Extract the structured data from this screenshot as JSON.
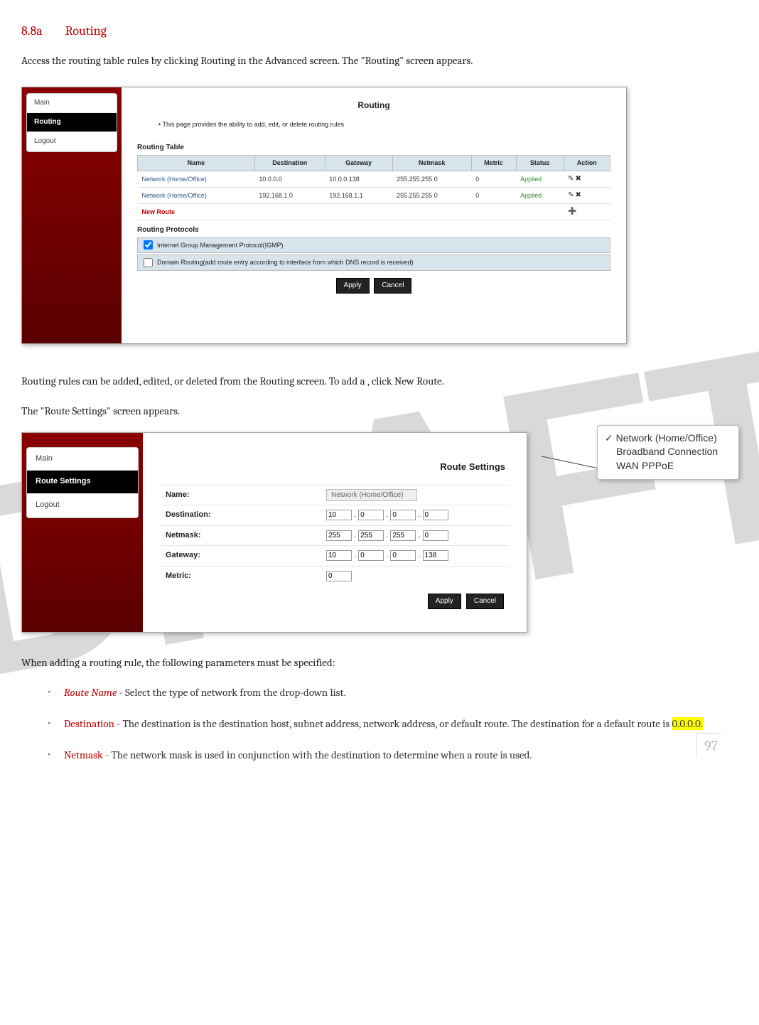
{
  "watermark": "DRAFT",
  "section": {
    "number": "8.8a",
    "title": "Routing"
  },
  "intro": "Access the routing table rules by clicking Routing in the Advanced screen. The \"Routing\" screen appears.",
  "shot1": {
    "sidebar": {
      "items": [
        "Main",
        "Routing",
        "Logout"
      ],
      "active": "Routing"
    },
    "title": "Routing",
    "note": "This page provides the ability to add, edit, or delete routing rules",
    "table_heading": "Routing Table",
    "columns": [
      "Name",
      "Destination",
      "Gateway",
      "Netmask",
      "Metric",
      "Status",
      "Action"
    ],
    "rows": [
      {
        "name": "Network (Home/Office)",
        "dest": "10.0.0.0",
        "gw": "10.0.0.138",
        "mask": "255.255.255.0",
        "metric": "0",
        "status": "Applied"
      },
      {
        "name": "Network (Home/Office)",
        "dest": "192.168.1.0",
        "gw": "192.168.1.1",
        "mask": "255.255.255.0",
        "metric": "0",
        "status": "Applied"
      }
    ],
    "new_route": "New Route",
    "protocols_heading": "Routing Protocols",
    "proto_igmp": {
      "checked": true,
      "label": "Internet Group Management Protocol(IGMP)"
    },
    "proto_domain": {
      "checked": false,
      "label": "Domain Routing(add route entry according to interface from which DNS record is received)"
    },
    "apply": "Apply",
    "cancel": "Cancel"
  },
  "mid_text_1": "Routing rules can be added, edited, or deleted from the Routing screen. To add a , click New Route.",
  "mid_text_2": "The \"Route Settings\" screen appears.",
  "shot2": {
    "sidebar": {
      "items": [
        "Main",
        "Route Settings",
        "Logout"
      ],
      "active": "Route Settings"
    },
    "title": "Route Settings",
    "fields": {
      "name_label": "Name:",
      "name_value": "Network (Home/Office)",
      "dest_label": "Destination:",
      "dest": [
        "10",
        "0",
        "0",
        "0"
      ],
      "mask_label": "Netmask:",
      "mask": [
        "255",
        "255",
        "255",
        "0"
      ],
      "gw_label": "Gateway:",
      "gw": [
        "10",
        "0",
        "0",
        "138"
      ],
      "metric_label": "Metric:",
      "metric": "0"
    },
    "apply": "Apply",
    "cancel": "Cancel",
    "callout": {
      "selected": "Network (Home/Office)",
      "opt2": "Broadband Connection",
      "opt3": "WAN PPPoE"
    }
  },
  "params_intro": "When adding a routing rule, the following parameters must be specified:",
  "params": {
    "route_name_term": "Route Name",
    "route_name_rest": " - Select the type of network from the drop-down list.",
    "dest_term": "Destination",
    "dest_rest_a": " - The destination is the destination host, subnet address, network address, or default route. The destination for a default route is ",
    "dest_hl": "0.0.0.0.",
    "netmask_term": "Netmask",
    "netmask_rest": " - The network mask is used in conjunction with the destination to determine when a route is used."
  },
  "page_number": "97"
}
